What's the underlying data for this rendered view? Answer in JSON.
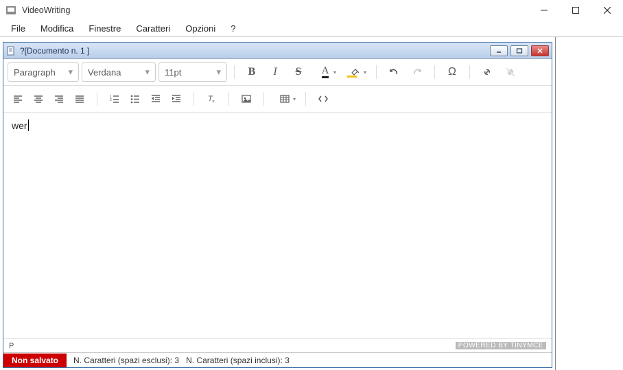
{
  "app": {
    "title": "VideoWriting"
  },
  "menu": {
    "file": "File",
    "modifica": "Modifica",
    "finestre": "Finestre",
    "caratteri": "Caratteri",
    "opzioni": "Opzioni",
    "help": "?"
  },
  "doc": {
    "title": "?[Documento n. 1 ]"
  },
  "toolbar": {
    "paragraph": "Paragraph",
    "font": "Verdana",
    "size": "11pt"
  },
  "editor": {
    "content": "wer",
    "path": "P",
    "powered": "POWERED BY TINYMCE"
  },
  "status": {
    "save_state": "Non salvato",
    "chars_excl_label": "N. Caratteri (spazi esclusi):",
    "chars_excl_val": "3",
    "chars_incl_label": "N. Caratteri (spazi inclusi):",
    "chars_incl_val": "3"
  }
}
